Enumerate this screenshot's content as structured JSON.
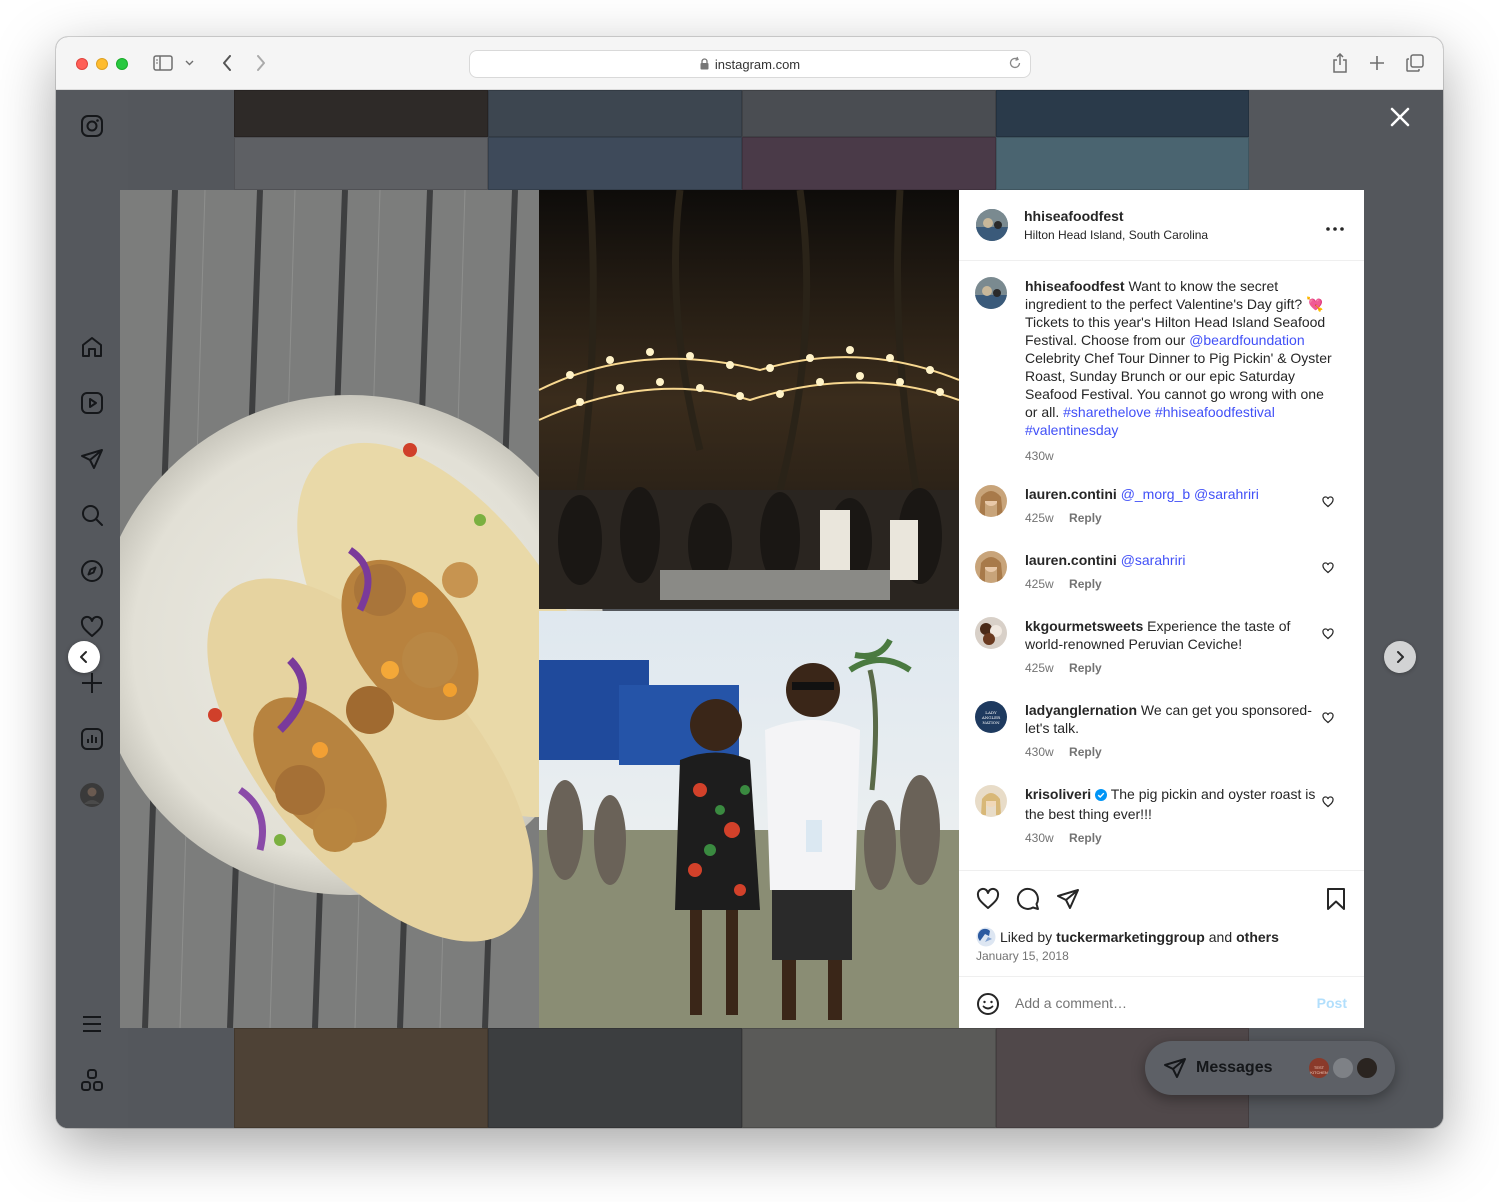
{
  "browser": {
    "url": "instagram.com"
  },
  "post": {
    "username": "hhiseafoodfest",
    "location": "Hilton Head Island, South Carolina",
    "caption": {
      "username": "hhiseafoodfest",
      "text_1": "Want to know the secret ingredient to the perfect Valentine's Day gift? 💘 Tickets to this year's Hilton Head Island Seafood Festival. Choose from our",
      "mention": "@beardfoundation",
      "text_2": "Celebrity Chef Tour Dinner to Pig Pickin' & Oyster Roast, Sunday Brunch or our epic Saturday Seafood Festival. You cannot go wrong with one or all.",
      "hashtag_1": "#sharethelove",
      "hashtag_2": "#hhiseafoodfestival",
      "hashtag_3": "#valentinesday",
      "age": "430w"
    },
    "comments": [
      {
        "username": "lauren.contini",
        "mention_1": "@_morg_b",
        "mention_2": "@sarahriri",
        "text": "",
        "age": "425w",
        "reply": "Reply"
      },
      {
        "username": "lauren.contini",
        "mention_1": "@sarahriri",
        "text": "",
        "age": "425w",
        "reply": "Reply"
      },
      {
        "username": "kkgourmetsweets",
        "text": "Experience the taste of world-renowned Peruvian Ceviche!",
        "age": "425w",
        "reply": "Reply"
      },
      {
        "username": "ladyanglernation",
        "text": "We can get you sponsored- let's talk.",
        "age": "430w",
        "reply": "Reply",
        "avatar_text": "LADY ANGLER NATION"
      },
      {
        "username": "krisoliveri",
        "text": "The pig pickin and oyster roast is the best thing ever!!!",
        "age": "430w",
        "reply": "Reply",
        "verified": true
      }
    ],
    "liked_by_prefix": "Liked by",
    "liked_by_user": "tuckermarketinggroup",
    "liked_by_and": "and",
    "liked_by_others": "others",
    "date": "January 15, 2018",
    "add_comment_placeholder": "Add a comment…",
    "post_button": "Post"
  },
  "messages": {
    "label": "Messages",
    "avatar_text": "TEST KITCHEN"
  },
  "icons": {
    "rail": [
      "instagram-icon",
      "home-icon",
      "reels-icon",
      "direct-icon",
      "search-icon",
      "explore-icon",
      "heart-icon",
      "create-icon",
      "insights-icon",
      "profile-avatar",
      "menu-icon",
      "more-icon"
    ]
  },
  "colors": {
    "link": "#4150f7",
    "verified": "#0095f6",
    "post_button": "#b2dffc"
  }
}
